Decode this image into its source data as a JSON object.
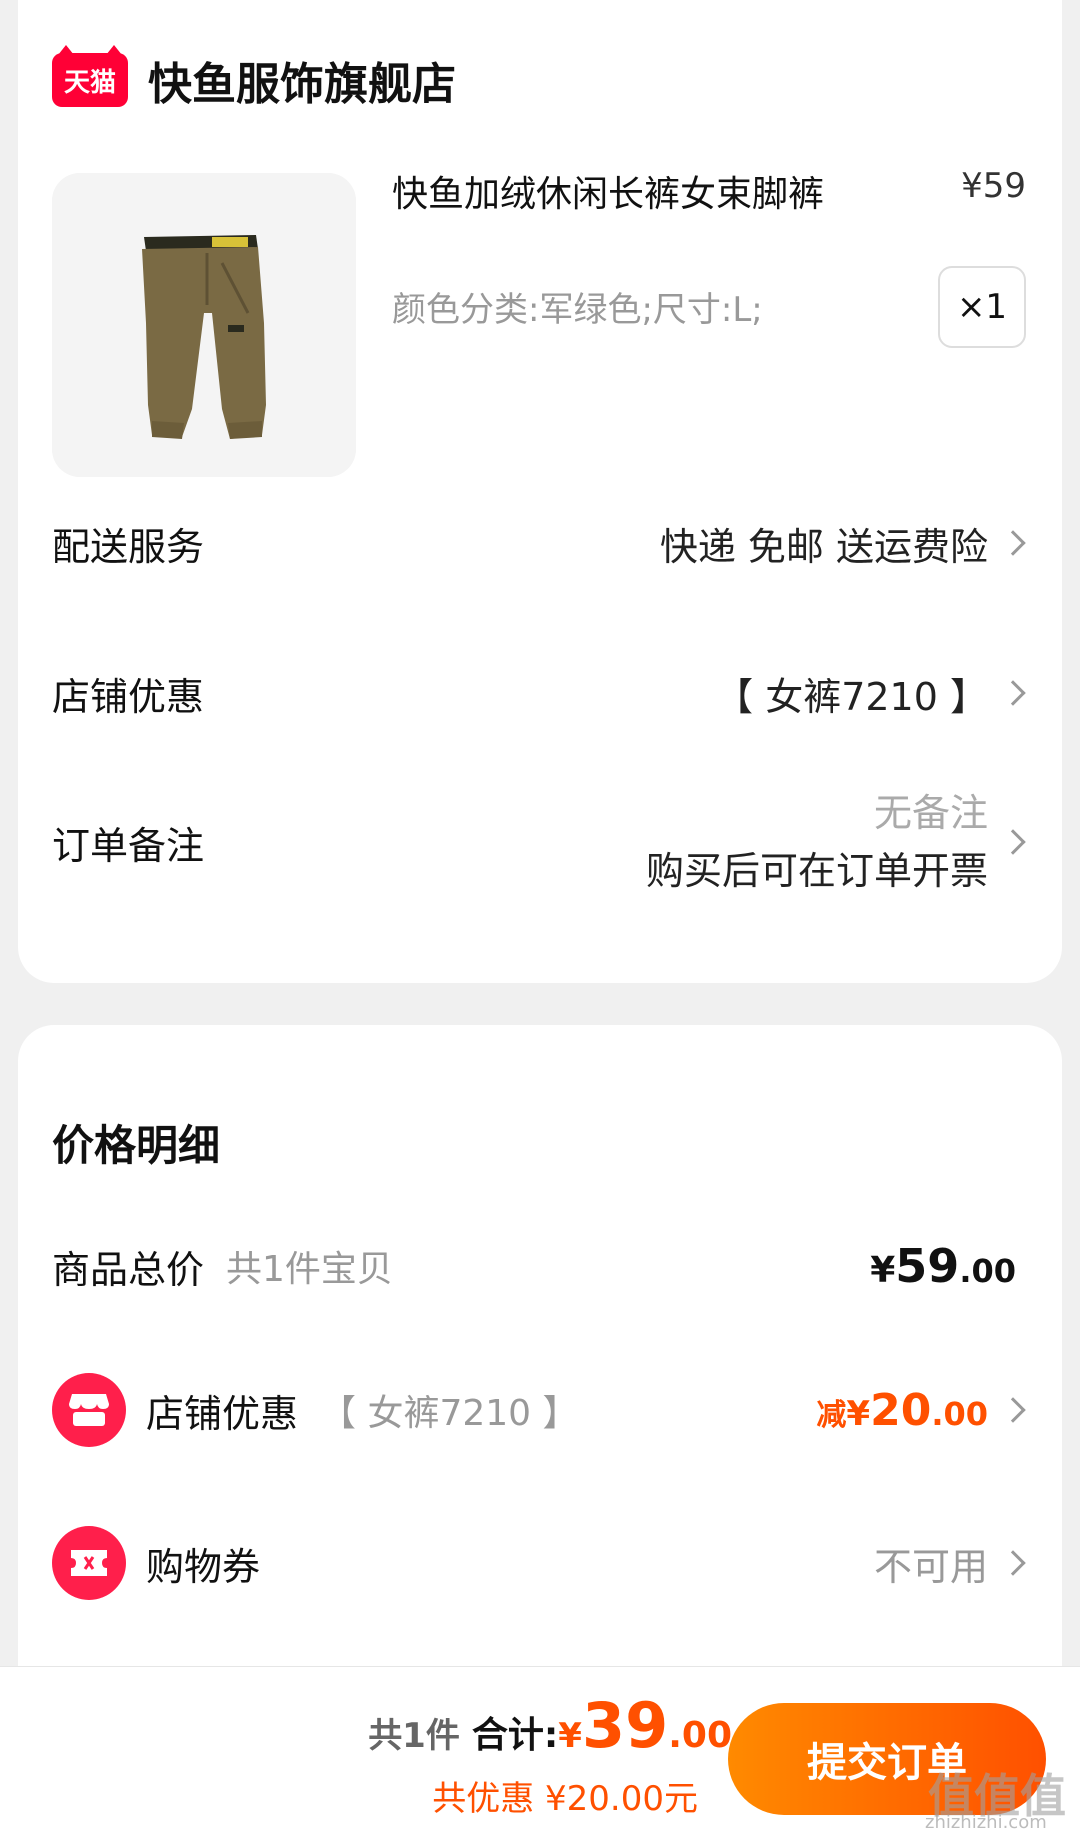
{
  "colors": {
    "tmall_red": "#ff0036",
    "accent_orange": "#ff5000",
    "button_gradient_start": "#ff8a00",
    "button_gradient_end": "#ff5000",
    "page_background": "#f0f0f0"
  },
  "store": {
    "logo_text": "天猫",
    "name": "快鱼服饰旗舰店"
  },
  "product": {
    "image_icon": "olive-jogger-pants-image",
    "title": "快鱼加绒休闲长裤女束脚裤",
    "price": "¥59",
    "sku": "颜色分类:军绿色;尺寸:L;",
    "quantity": "×1"
  },
  "order_rows": {
    "delivery": {
      "label": "配送服务",
      "value": "快递 免邮 送运费险"
    },
    "shop_discount": {
      "label": "店铺优惠",
      "value": "【 女裤7210 】"
    },
    "note": {
      "label": "订单备注",
      "value_line1": "无备注",
      "value_line2": "购买后可在订单开票"
    }
  },
  "price_detail": {
    "title": "价格明细",
    "subtotal": {
      "label": "商品总价",
      "hint": "共1件宝贝",
      "currency": "¥",
      "int": "59",
      "dec": ".00"
    },
    "shop_discount": {
      "label": "店铺优惠",
      "hint": "【 女裤7210 】",
      "prefix": "减",
      "currency": "¥",
      "int": "20",
      "dec": ".00",
      "icon": "store-icon"
    },
    "coupon": {
      "label": "购物券",
      "value": "不可用",
      "icon": "ticket-icon"
    }
  },
  "bottom_bar": {
    "count": "共1件",
    "total_label": "合计:",
    "currency": "¥",
    "total_int": "39",
    "total_dec": ".00",
    "saved": "共优惠 ¥20.00元",
    "submit_label": "提交订单"
  },
  "watermark": {
    "text": "值值值",
    "sub": "zhizhizhi.com"
  }
}
